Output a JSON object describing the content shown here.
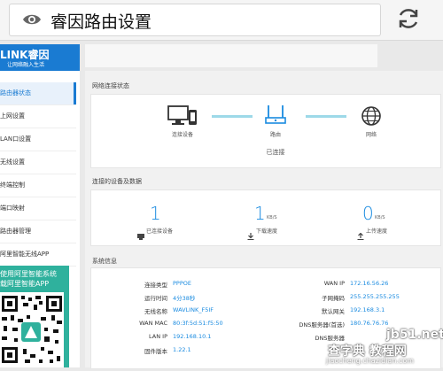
{
  "browser": {
    "url_title": "睿因路由设置"
  },
  "brand": {
    "name": "LINK睿因",
    "slogan": "让网络融入生活"
  },
  "nav": [
    "路由器状态",
    "上网设置",
    "LAN口设置",
    "无线设置",
    "终端控制",
    "端口映射",
    "路由器管理"
  ],
  "nav_app": "阿里智能无线APP",
  "app_card": {
    "line1": "使用阿里智能系统",
    "line2": "载阿里智能APP"
  },
  "network_status": {
    "title": "网络连接状态",
    "device_label": "连接设备",
    "router_label": "路由",
    "internet_label": "网络",
    "status": "已连接"
  },
  "devices": {
    "title": "连接的设备及数据",
    "connected_count": "1",
    "connected_label": "已连接设备",
    "download_value": "1",
    "download_unit": "KB/S",
    "download_label": "下载速度",
    "upload_value": "0",
    "upload_unit": "KB/S",
    "upload_label": "上传速度"
  },
  "system": {
    "title": "系统信息",
    "left": [
      {
        "key": "连接类型",
        "value": "PPPOE"
      },
      {
        "key": "运行时间",
        "value": "4分38秒"
      },
      {
        "key": "无线名称",
        "value": "WAVLINK_F5IF"
      },
      {
        "key": "WAN MAC",
        "value": "80:3f:5d:51:f5:50"
      },
      {
        "key": "LAN IP",
        "value": "192.168.10.1"
      },
      {
        "key": "固件版本",
        "value": "1.22.1"
      }
    ],
    "right": [
      {
        "key": "WAN IP",
        "value": "172.16.56.26"
      },
      {
        "key": "子网掩码",
        "value": "255.255.255.255"
      },
      {
        "key": "默认网关",
        "value": "192.168.3.1"
      },
      {
        "key": "DNS服务器(首选)",
        "value": "180.76.76.76"
      },
      {
        "key": "DNS服务器",
        "value": ""
      }
    ]
  },
  "watermark": {
    "site": "jb51.net",
    "name": "查字典 教程网",
    "url": "jiaocheng.chazidian.com"
  },
  "colors": {
    "accent": "#1a8be0",
    "brand": "#1a7bd2",
    "app_green": "#2fb19d"
  }
}
